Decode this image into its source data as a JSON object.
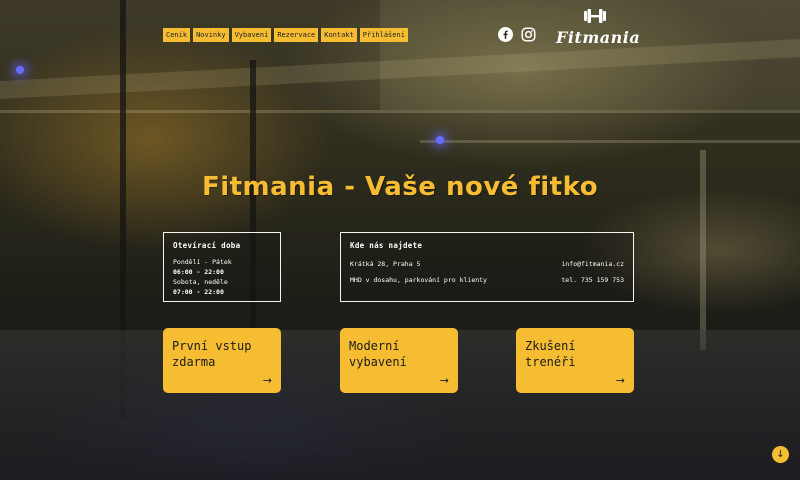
{
  "nav": {
    "items": [
      {
        "label": "Ceník"
      },
      {
        "label": "Novinky"
      },
      {
        "label": "Vybavení"
      },
      {
        "label": "Rezervace"
      },
      {
        "label": "Kontakt"
      },
      {
        "label": "Přihlášení"
      }
    ]
  },
  "social": {
    "icons": [
      "facebook-icon",
      "instagram-icon"
    ]
  },
  "logo": {
    "text": "Fitmania",
    "icon": "dumbbell-icon"
  },
  "hero": {
    "headline": "Fitmania - Vaše nové fitko"
  },
  "hours": {
    "title": "Otevírací doba",
    "weekday_label": "Pondělí - Pátek",
    "weekday_time": "06:00 - 22:00",
    "weekend_label": "Sobota, neděle",
    "weekend_time": "07:00 - 22:00"
  },
  "location": {
    "title": "Kde nás najdete",
    "address": "Krátká 28, Praha 5",
    "transport": "MHD v dosahu, parkování pro klienty",
    "email": "info@fitmania.cz",
    "phone": "tel. 735 159 753"
  },
  "cards": [
    {
      "title": "První vstup\nzdarma",
      "arrow": "→"
    },
    {
      "title": "Moderní\nvybavení",
      "arrow": "→"
    },
    {
      "title": "Zkušení\ntrenéři",
      "arrow": "→"
    }
  ],
  "scroll": {
    "arrow": "↓"
  },
  "colors": {
    "accent": "#f6bd33"
  }
}
